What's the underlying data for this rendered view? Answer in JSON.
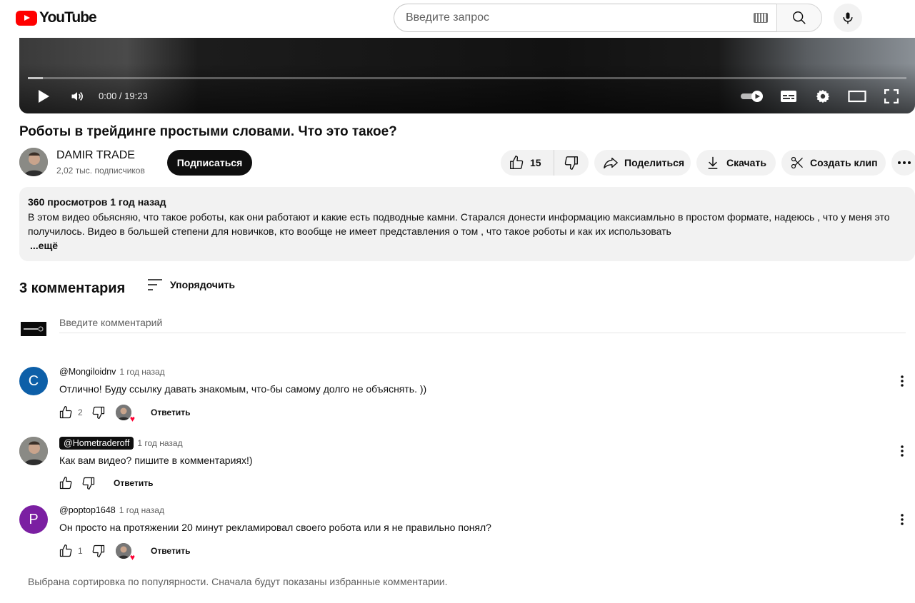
{
  "masthead": {
    "logo_text": "YouTube",
    "search_placeholder": "Введите запрос"
  },
  "player": {
    "time": "0:00 / 19:23",
    "progress": 0.017
  },
  "video": {
    "title": "Роботы в трейдинге простыми словами. Что это такое?",
    "channel_name": "DAMIR TRADE",
    "subscribers": "2,02 тыс. подписчиков",
    "subscribe_label": "Подписаться",
    "likes": "15",
    "share_label": "Поделиться",
    "download_label": "Скачать",
    "clip_label": "Создать клип"
  },
  "description": {
    "meta": "360 просмотров  1 год назад",
    "text": "В этом видео обьясняю, что такое роботы, как они работают и какие есть подводные камни. Старался донести информацию максиамльно в простом формате, надеюсь , что у меня это получилось. Видео в большей степени для новичков, кто вообще не имеет представления о том , что такое роботы и как их использовать",
    "more": "...ещё"
  },
  "comments_section": {
    "count_label": "3 комментария",
    "sort_label": "Упорядочить",
    "input_placeholder": "Введите комментарий",
    "footer_note": "Выбрана сортировка по популярности. Сначала будут показаны избранные комментарии."
  },
  "comments": [
    {
      "author": "@Mongiloidnv",
      "time": "1 год назад",
      "text": "Отлично! Буду ссылку давать знакомым, что-бы самому долго не объяснять. ))",
      "likes": "2",
      "reply_label": "Ответить",
      "avatar_letter": "C",
      "avatar_color": "#0d5fa8"
    },
    {
      "author": "@Hometraderoff",
      "time": "1 год назад",
      "text": "Как вам видео? пишите в комментариях!)",
      "likes": "",
      "reply_label": "Ответить"
    },
    {
      "author": "@poptop1648",
      "time": "1 год назад",
      "text": "Он просто на протяжении 20 минут рекламировал своего робота или я не правильно понял?",
      "likes": "1",
      "reply_label": "Ответить",
      "avatar_letter": "P",
      "avatar_color": "#7b1fa2"
    }
  ],
  "colors": {
    "brand": "#ff0000",
    "text": "#0f0f0f",
    "secondary_text": "#606060",
    "chip_bg": "#f2f2f2"
  }
}
